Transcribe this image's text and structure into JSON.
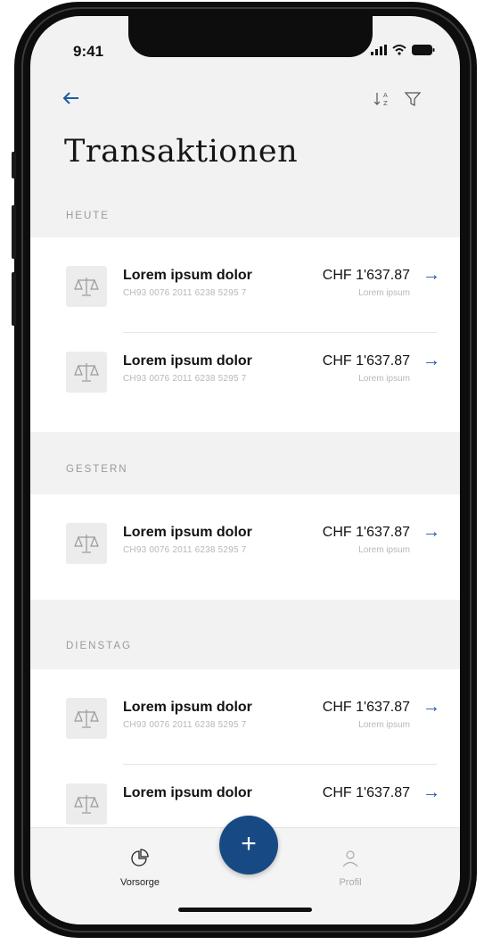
{
  "status_bar": {
    "time": "9:41"
  },
  "header": {
    "title": "Transaktionen",
    "back_icon": "arrow-left-icon",
    "sort_icon": "sort-az-icon",
    "filter_icon": "filter-icon"
  },
  "sections": [
    {
      "label": "HEUTE",
      "items": [
        {
          "title": "Lorem ipsum dolor",
          "iban": "CH93 0076 2011 6238 5295 7",
          "amount": "CHF 1'637.87",
          "sub": "Lorem ipsum"
        },
        {
          "title": "Lorem ipsum dolor",
          "iban": "CH93 0076 2011 6238 5295 7",
          "amount": "CHF 1'637.87",
          "sub": "Lorem ipsum"
        }
      ]
    },
    {
      "label": "GESTERN",
      "items": [
        {
          "title": "Lorem ipsum dolor",
          "iban": "CH93 0076 2011 6238 5295 7",
          "amount": "CHF 1'637.87",
          "sub": "Lorem ipsum"
        }
      ]
    },
    {
      "label": "DIENSTAG",
      "items": [
        {
          "title": "Lorem ipsum dolor",
          "iban": "CH93 0076 2011 6238 5295 7",
          "amount": "CHF 1'637.87",
          "sub": "Lorem ipsum"
        },
        {
          "title": "Lorem ipsum dolor",
          "iban": "",
          "amount": "CHF 1'637.87",
          "sub": ""
        }
      ]
    }
  ],
  "tabbar": {
    "tabs": [
      {
        "label": "Vorsorge",
        "icon": "pie-chart-icon",
        "active": true
      },
      {
        "label": "Profil",
        "icon": "person-icon",
        "active": false
      }
    ],
    "fab_label": "+"
  },
  "colors": {
    "accent": "#1f5aa6",
    "fab": "#174a85",
    "background": "#f2f2f2"
  }
}
